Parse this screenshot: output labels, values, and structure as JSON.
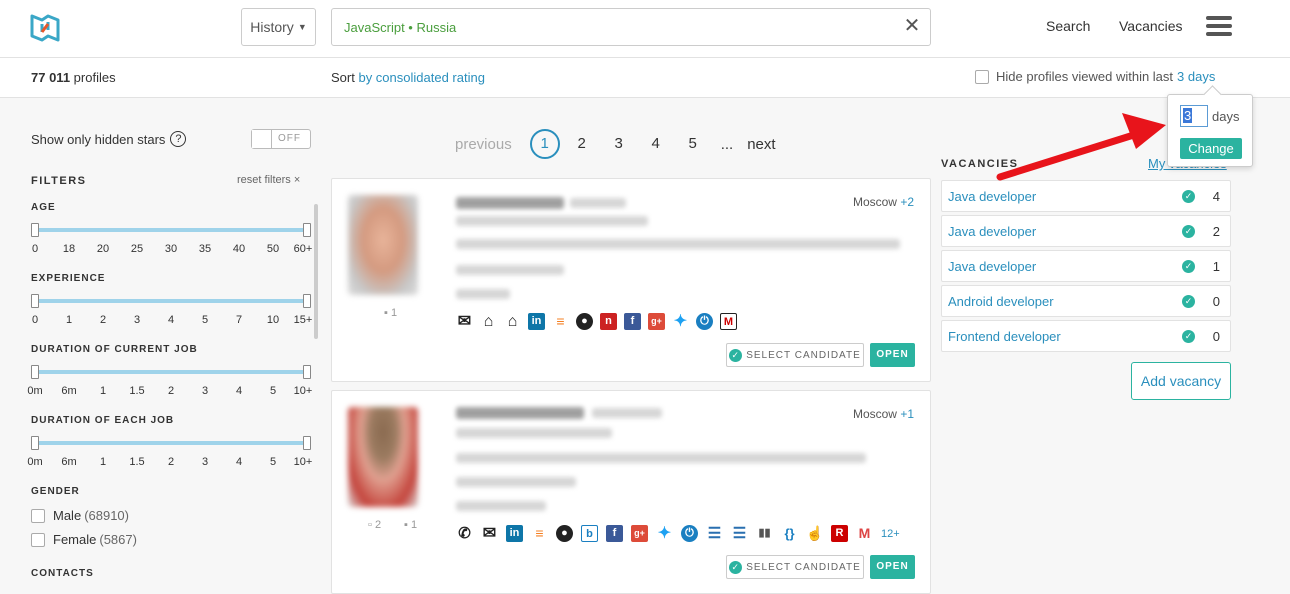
{
  "header": {
    "history_label": "History",
    "search_value": "JavaScript • Russia",
    "nav_search": "Search",
    "nav_vacancies": "Vacancies"
  },
  "subbar": {
    "profiles_count": "77 011",
    "profiles_label": "profiles",
    "sort_label": "Sort",
    "sort_value": "by consolidated rating",
    "hide_label": "Hide profiles viewed within last",
    "hide_value": "3 days"
  },
  "popover": {
    "days_value": "3",
    "days_unit": "days",
    "change_label": "Change"
  },
  "sidebar": {
    "hidden_stars_label": "Show only hidden stars",
    "toggle_label": "OFF",
    "filters_title": "FILTERS",
    "reset_filters": "reset filters  ×",
    "filters": [
      {
        "title": "AGE",
        "ticks": [
          "0",
          "18",
          "20",
          "25",
          "30",
          "35",
          "40",
          "50",
          "60+"
        ]
      },
      {
        "title": "EXPERIENCE",
        "ticks": [
          "0",
          "1",
          "2",
          "3",
          "4",
          "5",
          "7",
          "10",
          "15+"
        ]
      },
      {
        "title": "DURATION OF CURRENT JOB",
        "ticks": [
          "0m",
          "6m",
          "1",
          "1.5",
          "2",
          "3",
          "4",
          "5",
          "10+"
        ]
      },
      {
        "title": "DURATION OF EACH JOB",
        "ticks": [
          "0m",
          "6m",
          "1",
          "1.5",
          "2",
          "3",
          "4",
          "5",
          "10+"
        ]
      }
    ],
    "gender_title": "GENDER",
    "gender": [
      {
        "label": "Male",
        "count": "(68910)"
      },
      {
        "label": "Female",
        "count": "(5867)"
      }
    ],
    "contacts_title": "CONTACTS"
  },
  "pagination": {
    "previous": "previous",
    "pages": [
      "1",
      "2",
      "3",
      "4",
      "5"
    ],
    "dots": "...",
    "next": "next"
  },
  "cards": [
    {
      "city": "Moscow",
      "more": "+2",
      "select_label": "SELECT CANDIDATE",
      "open_label": "OPEN",
      "sub_count": "1"
    },
    {
      "city": "Moscow",
      "more": "+1",
      "select_label": "SELECT CANDIDATE",
      "open_label": "OPEN",
      "sub_count_1": "2",
      "sub_count_2": "1",
      "more_icons": "12+"
    }
  ],
  "vacancies": {
    "title": "VACANCIES",
    "my_link": "My vacancies",
    "items": [
      {
        "name": "Java developer",
        "count": "4"
      },
      {
        "name": "Java developer",
        "count": "2"
      },
      {
        "name": "Java developer",
        "count": "1"
      },
      {
        "name": "Android developer",
        "count": "0"
      },
      {
        "name": "Frontend developer",
        "count": "0"
      }
    ],
    "add_label": "Add vacancy"
  },
  "colors": {
    "accent": "#2bb3a0",
    "link": "#2a8fbd",
    "search_text": "#4a9e3d",
    "arrow": "#e8141b"
  }
}
